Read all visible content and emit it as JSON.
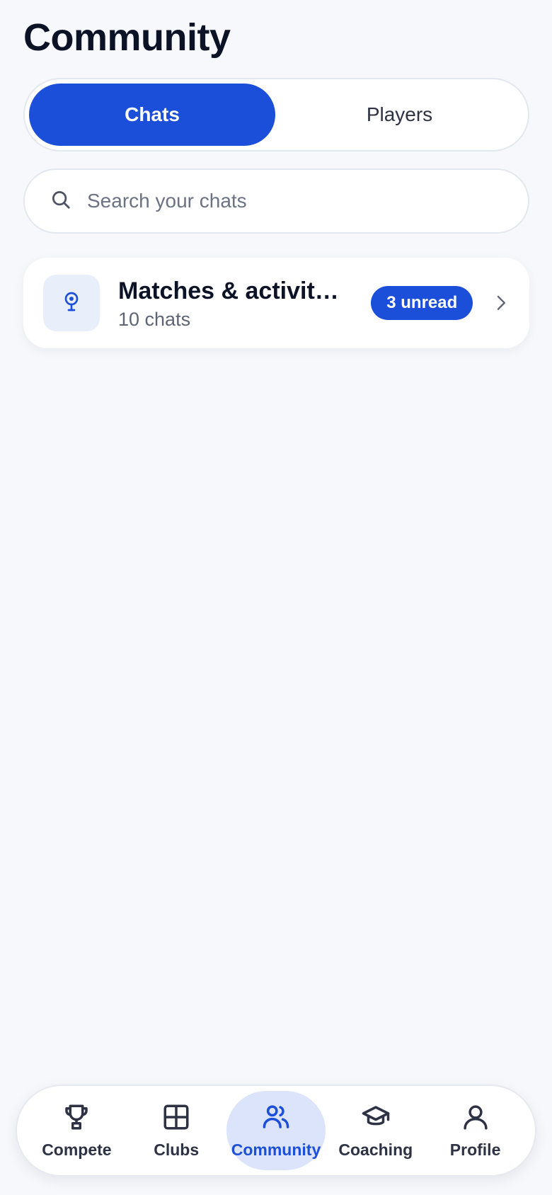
{
  "header": {
    "title": "Community"
  },
  "tabs": [
    {
      "label": "Chats",
      "active": true
    },
    {
      "label": "Players",
      "active": false
    }
  ],
  "search": {
    "placeholder": "Search your chats",
    "value": "",
    "icon": "search-icon"
  },
  "chat_groups": [
    {
      "title": "Matches & activit…",
      "subtitle": "10 chats",
      "badge": "3 unread",
      "icon": "pin-icon"
    }
  ],
  "bottom_nav": [
    {
      "label": "Compete",
      "icon": "trophy-icon",
      "active": false
    },
    {
      "label": "Clubs",
      "icon": "grid-icon",
      "active": false
    },
    {
      "label": "Community",
      "icon": "users-icon",
      "active": true
    },
    {
      "label": "Coaching",
      "icon": "graduation-cap-icon",
      "active": false
    },
    {
      "label": "Profile",
      "icon": "user-icon",
      "active": false
    }
  ],
  "colors": {
    "accent": "#1c4fd9",
    "background": "#f6f8fb",
    "nav_active_bg": "#dbe4fb"
  }
}
